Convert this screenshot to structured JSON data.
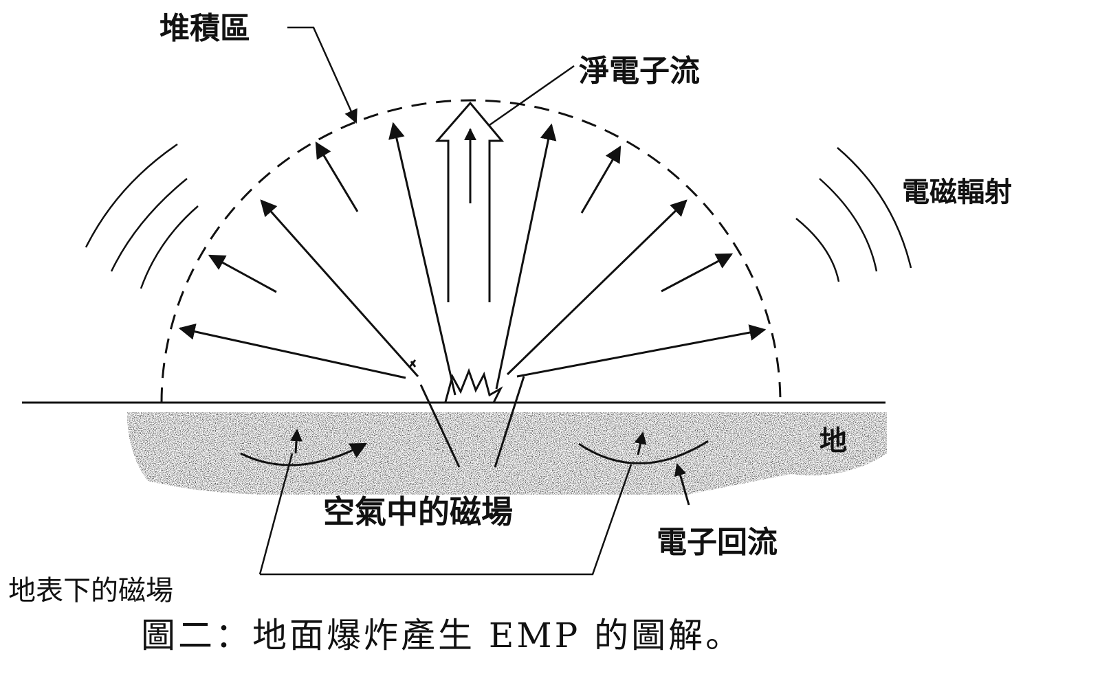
{
  "labels": {
    "deposition_region": "堆積區",
    "net_electron_current": "淨電子流",
    "em_radiation": "電磁輻射",
    "ground": "地",
    "air_magnetic_field": "空氣中的磁場",
    "electron_return_current": "電子回流",
    "subsurface_magnetic_field": "地表下的磁場"
  },
  "caption": "圖二：地面爆炸產生 EMP 的圖解。",
  "colors": {
    "ink": "#111111",
    "background": "#ffffff"
  }
}
